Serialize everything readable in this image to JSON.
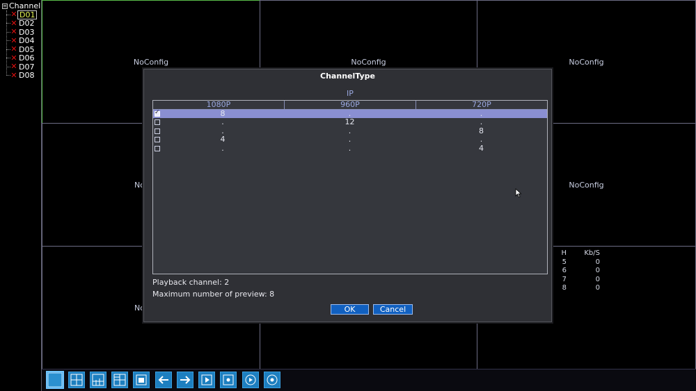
{
  "sidebar": {
    "root_label": "Channel",
    "items": [
      {
        "label": "D01",
        "selected": true
      },
      {
        "label": "D02"
      },
      {
        "label": "D03"
      },
      {
        "label": "D04"
      },
      {
        "label": "D05"
      },
      {
        "label": "D06"
      },
      {
        "label": "D07"
      },
      {
        "label": "D08"
      }
    ]
  },
  "preview": {
    "noconfig_label": "NoConfig",
    "truncated_label": "No",
    "stats": {
      "header": [
        "H",
        "Kb/S"
      ],
      "rows": [
        [
          "5",
          "0"
        ],
        [
          "6",
          "0"
        ],
        [
          "7",
          "0"
        ],
        [
          "8",
          "0"
        ]
      ]
    }
  },
  "dialog": {
    "title": "ChannelType",
    "group_label": "IP",
    "columns": [
      "1080P",
      "960P",
      "720P"
    ],
    "rows": [
      {
        "checked": true,
        "cells": [
          "8",
          ".",
          "."
        ]
      },
      {
        "checked": false,
        "cells": [
          ".",
          "12",
          "."
        ]
      },
      {
        "checked": false,
        "cells": [
          ".",
          ".",
          "8"
        ]
      },
      {
        "checked": false,
        "cells": [
          "4",
          ".",
          "."
        ]
      },
      {
        "checked": false,
        "cells": [
          ".",
          ".",
          "4"
        ]
      }
    ],
    "playback_channel": "Playback channel: 2",
    "max_preview": "Maximum number of preview: 8",
    "ok_label": "OK",
    "cancel_label": "Cancel"
  },
  "toolbar": {
    "buttons": [
      "single-view-icon",
      "quad-view-icon",
      "nine-view-icon",
      "sixteen-view-icon",
      "stop-icon",
      "arrow-left-icon",
      "arrow-right-icon",
      "playback-icon",
      "record-icon",
      "play-circle-icon",
      "dot-circle-icon"
    ]
  },
  "colors": {
    "active_cell_border": "#5bbf4a",
    "cell_border": "#6e6e86",
    "selected_row": "#8a8fd2",
    "button_blue": "#1160c0",
    "toolbar_button": "#1d7fc0"
  }
}
